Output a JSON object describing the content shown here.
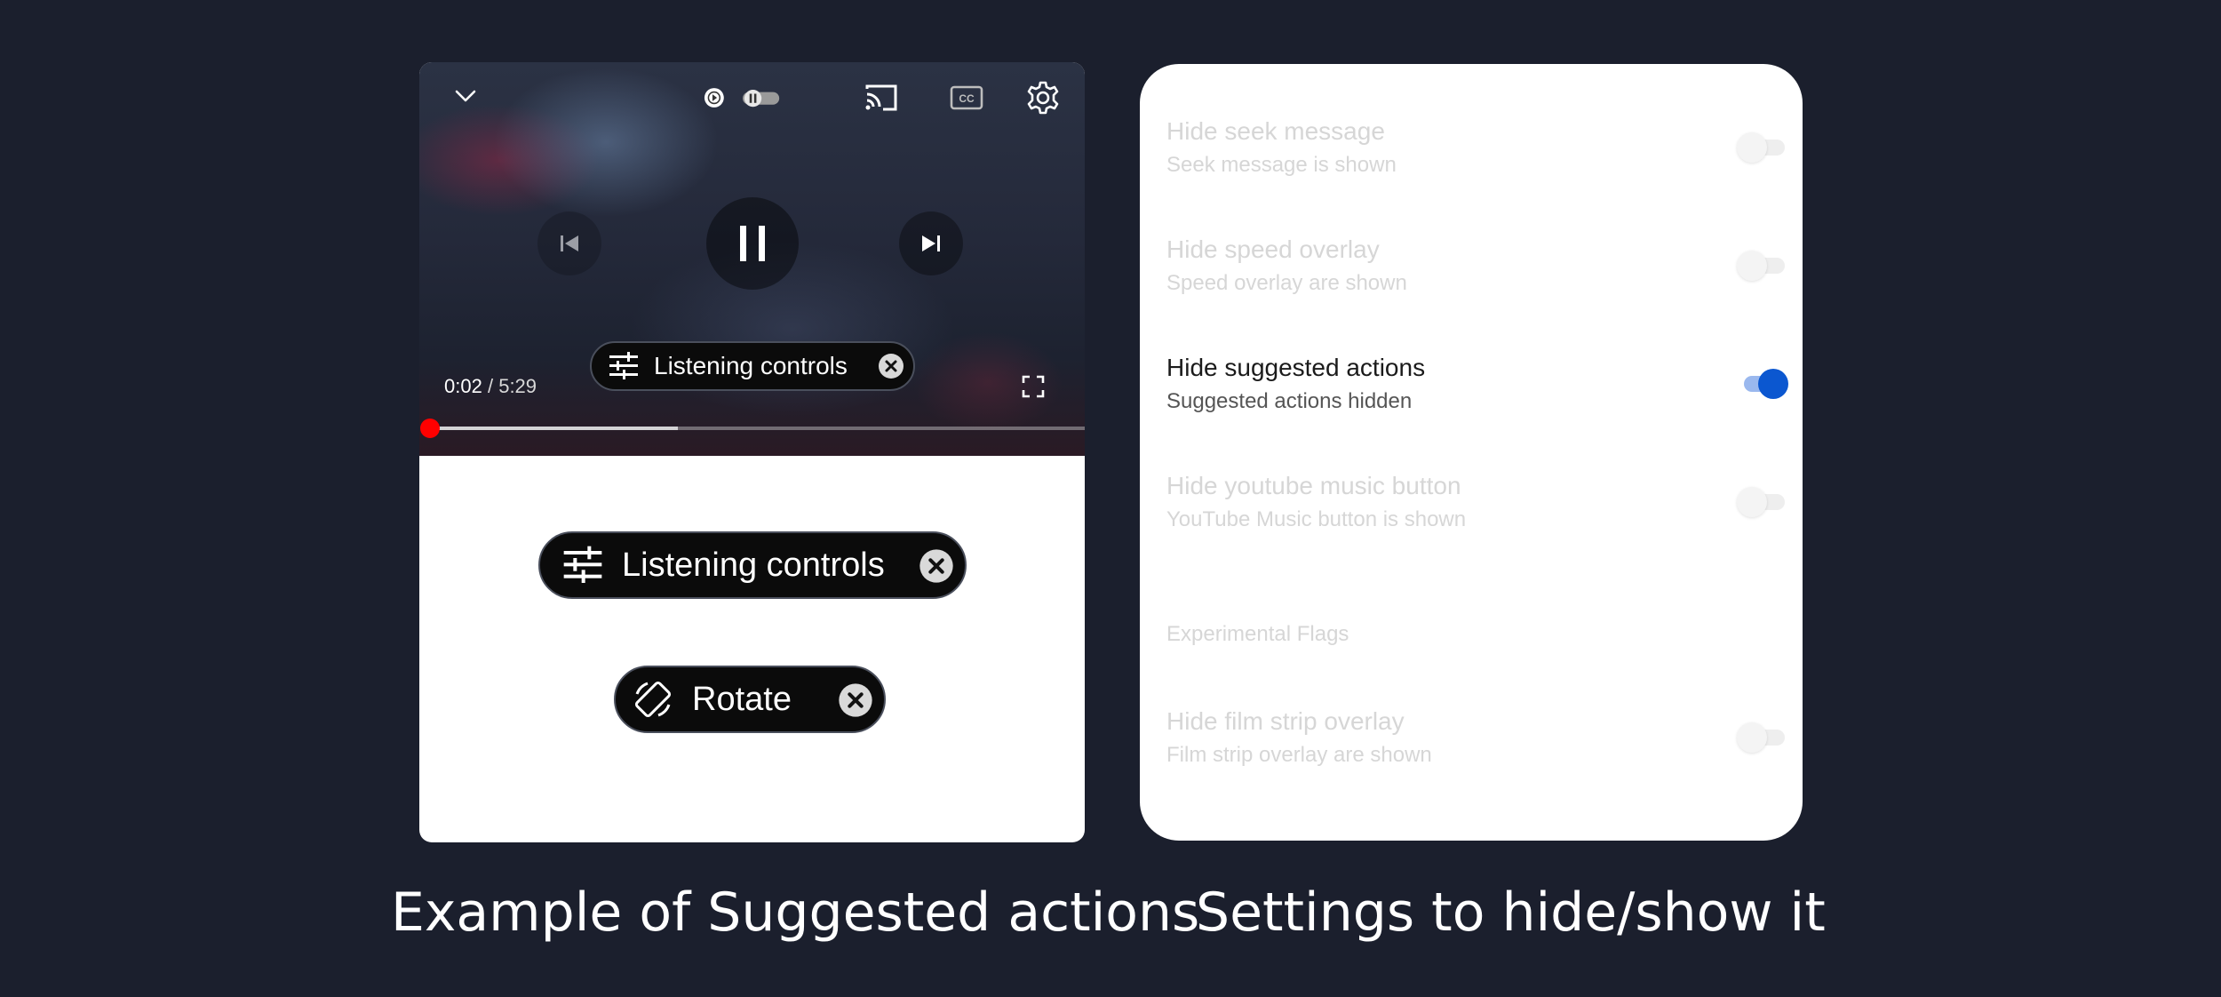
{
  "player": {
    "time_current": "0:02",
    "time_separator": "/",
    "time_total": "5:29",
    "progress_played_fraction": 0.0,
    "progress_buffered_fraction": 0.38,
    "chip_overlay_label": "Listening controls",
    "icons": [
      "chevron-down-icon",
      "autoplay-toggle-icon",
      "cast-icon",
      "captions-icon",
      "gear-icon",
      "previous-icon",
      "pause-icon",
      "next-icon",
      "fullscreen-icon"
    ]
  },
  "examples": {
    "listening_controls_label": "Listening controls",
    "rotate_label": "Rotate"
  },
  "settings": {
    "items": [
      {
        "title": "Hide seek message",
        "subtitle": "Seek message is shown",
        "enabled": false
      },
      {
        "title": "Hide speed overlay",
        "subtitle": "Speed overlay are shown",
        "enabled": false
      },
      {
        "title": "Hide suggested actions",
        "subtitle": "Suggested actions hidden",
        "enabled": true
      },
      {
        "title": "Hide youtube music button",
        "subtitle": "YouTube Music button is shown",
        "enabled": false
      }
    ],
    "section_label": "Experimental Flags",
    "experimental_items": [
      {
        "title": "Hide film strip overlay",
        "subtitle": "Film strip overlay are shown",
        "enabled": false
      }
    ],
    "colors": {
      "toggle_on": "#0b57d0",
      "toggle_on_track": "#9ab8ee",
      "disabled_text": "#d6d6d6"
    }
  },
  "captions": {
    "left": "Example of Suggested actions",
    "right": "Settings to hide/show it"
  },
  "colors": {
    "background": "#1b1f2d",
    "progress": "#ff0000"
  }
}
